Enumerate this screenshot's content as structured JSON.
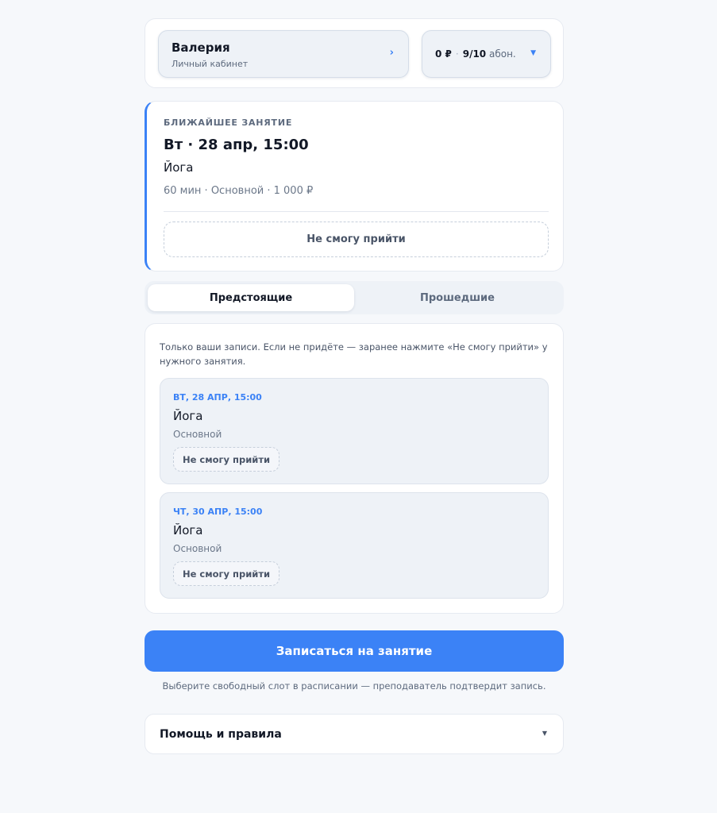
{
  "header": {
    "name": "Валерия",
    "subtitle": "Личный кабинет",
    "profile_chevron": "›",
    "balance_money": "0 ₽",
    "balance_sep": "·",
    "subscription_count": "9/10",
    "subscription_unit": "абон.",
    "balance_caret": "▼"
  },
  "next_lesson": {
    "kicker": "БЛИЖАЙШЕЕ ЗАНЯТИЕ",
    "date": "Вт · 28 апр, 15:00",
    "title": "Йога",
    "meta": "60 мин · Основной · 1 000 ₽",
    "cancel_label": "Не смогу прийти"
  },
  "tabs": {
    "upcoming": "Предстоящие",
    "past": "Прошедшие",
    "active": "upcoming"
  },
  "bookings": {
    "note": "Только ваши записи. Если не придёте — заранее нажмите «Не смогу прийти» у нужного занятия.",
    "items": [
      {
        "when": "ВТ, 28 АПР, 15:00",
        "title": "Йога",
        "type": "Основной",
        "cancel_label": "Не смогу прийти"
      },
      {
        "when": "ЧТ, 30 АПР, 15:00",
        "title": "Йога",
        "type": "Основной",
        "cancel_label": "Не смогу прийти"
      }
    ]
  },
  "cta": {
    "label": "Записаться на занятие",
    "hint": "Выберите свободный слот в расписании — преподаватель подтвердит запись."
  },
  "help": {
    "label": "Помощь и правила",
    "caret": "▼"
  },
  "colors": {
    "accent": "#3b82f6",
    "background": "#f6f8fb",
    "card": "#ffffff",
    "muted_panel": "#eef2f7"
  }
}
